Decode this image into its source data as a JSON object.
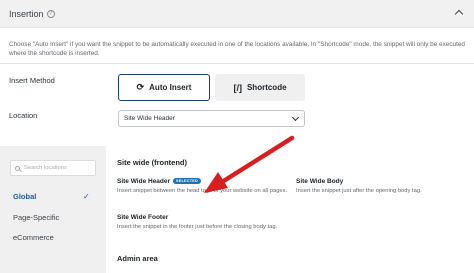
{
  "header": {
    "title": "Insertion",
    "help_icon": "question-circle-icon"
  },
  "description": "Choose \"Auto Insert\" if you want the snippet to be automatically executed in one of the locations available. In \"Shortcode\" mode, the snippet will only be executed where the shortcode is inserted.",
  "insert_method": {
    "label": "Insert Method",
    "options": [
      {
        "label": "Auto Insert",
        "icon": "refresh-icon",
        "selected": true
      },
      {
        "label": "Shortcode",
        "icon": "shortcode-brackets-icon",
        "selected": false
      }
    ]
  },
  "location": {
    "label": "Location",
    "value": "Site Wide Header"
  },
  "locations_panel": {
    "search_placeholder": "Search locations",
    "nav": [
      {
        "label": "Global",
        "active": true
      },
      {
        "label": "Page-Specific",
        "active": false
      },
      {
        "label": "eCommerce",
        "active": false
      }
    ],
    "groups": [
      {
        "title": "Site wide (frontend)",
        "items": [
          {
            "title": "Site Wide Header",
            "badge": "SELECTED",
            "desc": "Insert snippet between the head tags of your website on all pages."
          },
          {
            "title": "Site Wide Body",
            "desc": "Insert the snippet just after the opening body tag."
          },
          {
            "title": "Site Wide Footer",
            "desc": "Insert the snippet in the footer just before the closing body tag."
          }
        ]
      },
      {
        "title": "Admin area"
      }
    ]
  },
  "colors": {
    "accent": "#1a5ba6",
    "arrow": "#d81f1f",
    "badge": "#2271b1"
  }
}
